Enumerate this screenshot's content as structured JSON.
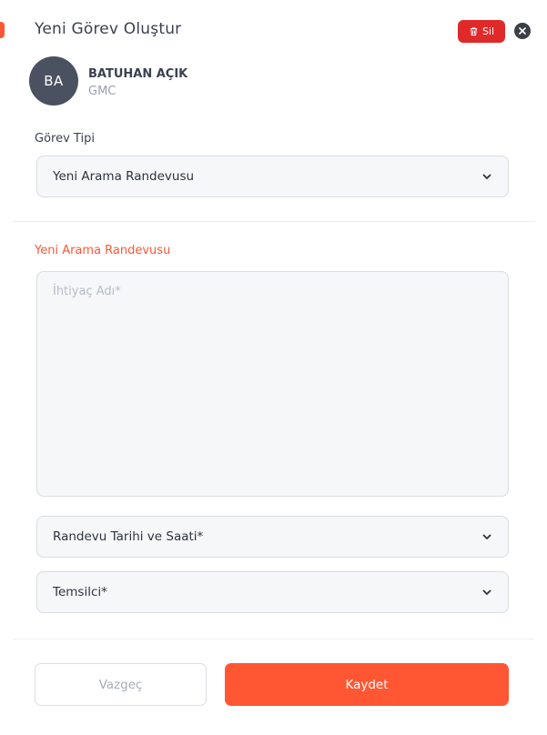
{
  "header": {
    "title": "Yeni Görev Oluştur",
    "delete_label": "Sil",
    "delete_icon": "trash-icon",
    "close_icon": "close-icon"
  },
  "user": {
    "initials": "BA",
    "name": "BATUHAN AÇIK",
    "company": "GMC"
  },
  "task_type": {
    "label": "Görev Tipi",
    "selected": "Yeni Arama Randevusu"
  },
  "details": {
    "section_title": "Yeni Arama Randevusu",
    "need_name_placeholder": "İhtiyaç Adı*",
    "need_name_value": "",
    "appointment_placeholder": "Randevu Tarihi ve Saati*",
    "representative_placeholder": "Temsilci*"
  },
  "footer": {
    "cancel_label": "Vazgeç",
    "save_label": "Kaydet"
  },
  "colors": {
    "accent": "#ff5733",
    "danger": "#e02a2a",
    "avatar_bg": "#4a5261",
    "field_bg": "#f5f7f9"
  }
}
